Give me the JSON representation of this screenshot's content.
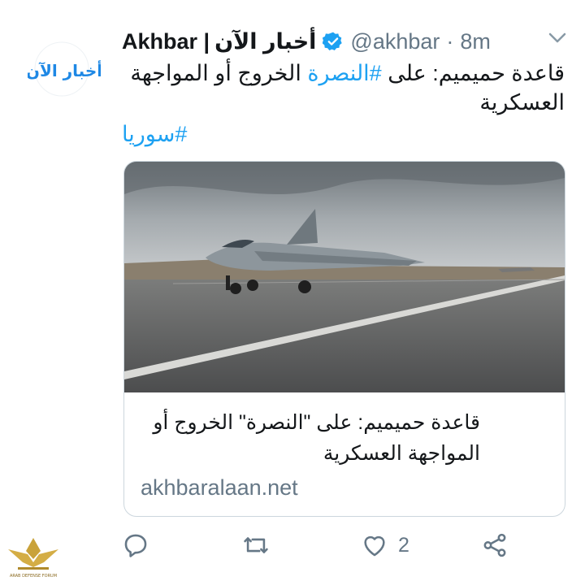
{
  "avatar": {
    "text": "أخبار الآن"
  },
  "tweet": {
    "display_name": "Akhbar |",
    "display_name_ar": "أخبار الآن",
    "handle": "@akhbar",
    "separator": "·",
    "time": "8m",
    "text_before_tag": "قاعدة حميميم: على ",
    "hashtag_inline": "#النصرة",
    "text_after_tag": " الخروج أو المواجهة العسكرية",
    "hashtag_line": "#سوريا"
  },
  "card": {
    "title": "قاعدة حميميم: على \"النصرة\" الخروج أو المواجهة العسكرية",
    "domain": "akhbaralaan.net"
  },
  "actions": {
    "like_count": "2"
  },
  "watermark": {
    "text": "ARAB DEFENSE FORUM"
  },
  "colors": {
    "accent": "#1da1f2",
    "muted": "#657786",
    "text": "#14171a",
    "avatar_blue": "#1e88e5"
  },
  "icons": [
    "verified-icon",
    "chevron-down-icon",
    "reply-icon",
    "retweet-icon",
    "like-icon",
    "share-icon"
  ]
}
